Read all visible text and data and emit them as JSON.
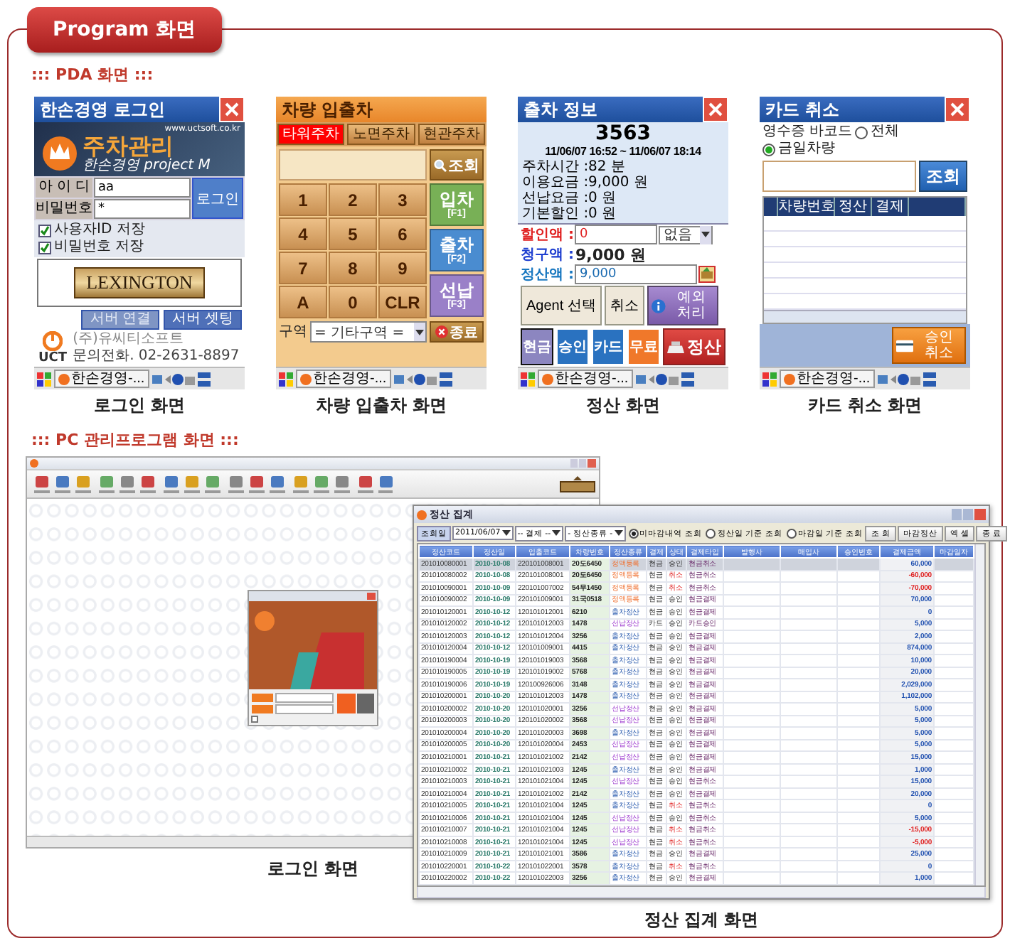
{
  "header": {
    "title": "Program 화면"
  },
  "pda_section": {
    "title": "::: PDA 화면 :::",
    "login_screen": {
      "title": "한손경영 로그인",
      "url": "www.uctsoft.co.kr",
      "banner_title": "주차관리",
      "banner_subtitle": "한손경영 project M",
      "id_label": "아 이 디",
      "id_value": "aa",
      "password_label": "비밀번호",
      "password_value": "*",
      "login_button": "로그인",
      "checkboxes": [
        {
          "label": "사용자ID 저장",
          "checked": true
        },
        {
          "label": "비밀번호 저장",
          "checked": true
        }
      ],
      "brand_logo": "LEXINGTON",
      "buttons": [
        {
          "label": "서버 연결",
          "disabled": true
        },
        {
          "label": "서버 셋팅",
          "disabled": false
        }
      ],
      "company_logo": "UCT",
      "company": "(주)유씨티소프트",
      "contact": "문의전화. 02-2631-8897",
      "taskbar_app": "한손경영-...",
      "caption": "로그인 화면"
    },
    "entry_screen": {
      "title": "차량 입출차",
      "tabs": [
        {
          "label": "타워주차",
          "selected": true
        },
        {
          "label": "노면주차",
          "selected": false
        },
        {
          "label": "현관주차",
          "selected": false
        }
      ],
      "search_button": "조회",
      "keys": [
        "1",
        "2",
        "3",
        "4",
        "5",
        "6",
        "7",
        "8",
        "9",
        "A",
        "0",
        "CLR"
      ],
      "actions": [
        {
          "label": "입차",
          "key": "[F1]",
          "color": "#78b056"
        },
        {
          "label": "출차",
          "key": "[F2]",
          "color": "#4a8cd0"
        },
        {
          "label": "선납",
          "key": "[F3]",
          "color": "#9a80c8"
        }
      ],
      "zone_label": "구역",
      "zone_value": "= 기타구역 =",
      "exit_button": "종료",
      "taskbar_app": "한손경영-...",
      "caption": "차량 입출차 화면"
    },
    "payment_screen": {
      "title": "출차 정보",
      "car_number": "3563",
      "period": "11/06/07 16:52 ~ 11/06/07 18:14",
      "info": [
        {
          "label": "주차시간",
          "value": ":82 분"
        },
        {
          "label": "이용요금",
          "value": ":9,000 원"
        },
        {
          "label": "선납요금",
          "value": ":0 원"
        },
        {
          "label": "기본할인",
          "value": ":0 원"
        }
      ],
      "discount_label": "할인액 :",
      "discount_value": "0",
      "discount_option": "없음",
      "billed_label": "청구액 :",
      "billed_value": "9,000 원",
      "settle_label": "정산액 :",
      "settle_value": "9,000",
      "agent_button": "Agent 선택",
      "cancel_button": "취소",
      "exception_button": "예외 처리",
      "pay_types": [
        {
          "label": "현금",
          "color": "#8c86c0",
          "selected": true
        },
        {
          "label": "승인",
          "color": "#2a72c0",
          "selected": false
        },
        {
          "label": "카드",
          "color": "#2a72c0",
          "selected": false
        },
        {
          "label": "무료",
          "color": "#f0782a",
          "selected": false
        }
      ],
      "settle_button": "정산",
      "taskbar_app": "한손경영-...",
      "caption": "정산 화면"
    },
    "card_cancel_screen": {
      "title": "카드 취소",
      "barcode_label": "영수증 바코드",
      "radios": [
        {
          "label": "전체",
          "selected": false
        },
        {
          "label": "금일차량",
          "selected": true
        }
      ],
      "search_button": "조회",
      "columns": [
        "차량번호",
        "정산",
        "결제"
      ],
      "cancel_button": "승인 취소",
      "taskbar_app": "한손경영-...",
      "caption": "카드 취소 화면"
    }
  },
  "pc_section": {
    "title": "::: PC 관리프로그램 화면 :::",
    "login_window": {
      "caption": "로그인 화면"
    },
    "settlement_window": {
      "title": "정산 집계",
      "toolbar": [
        {
          "kind": "label",
          "text": "조회일"
        },
        {
          "kind": "select",
          "text": "2011/06/07"
        },
        {
          "kind": "select",
          "text": "-- 결제 --"
        },
        {
          "kind": "select",
          "text": "- 정산종류 -"
        },
        {
          "kind": "radio",
          "text": "미마감내역 조회",
          "selected": true
        },
        {
          "kind": "radio",
          "text": "정산일 기준 조회",
          "selected": false
        },
        {
          "kind": "radio",
          "text": "마감일 기준 조회",
          "selected": false
        },
        {
          "kind": "button",
          "text": "조 회"
        },
        {
          "kind": "button",
          "text": "마감정산"
        },
        {
          "kind": "button",
          "text": "엑 셀"
        },
        {
          "kind": "button",
          "text": "종 료"
        }
      ],
      "columns": [
        "정산코드",
        "정산일",
        "입출코드",
        "차량번호",
        "정산종류",
        "결제",
        "상태",
        "결제타입",
        "발행사",
        "매입사",
        "승인번호",
        "결제금액",
        "마감일자"
      ],
      "rows": [
        {
          "code": "201010080001",
          "date": "2010-10-08",
          "io_code": "220101008001",
          "car": "20도6450",
          "type": "정액등록",
          "kind": "fixed",
          "pay": "현금",
          "status": "승인",
          "cancelled": false,
          "pay_type": "현금취소",
          "amount": "60,000",
          "refund": false,
          "selected": true
        },
        {
          "code": "201010080002",
          "date": "2010-10-08",
          "io_code": "220101008001",
          "car": "20도6450",
          "type": "정액등록",
          "kind": "fixed",
          "pay": "현금",
          "status": "취소",
          "cancelled": true,
          "pay_type": "현금취소",
          "amount": "-60,000",
          "refund": true,
          "selected": false
        },
        {
          "code": "201010090001",
          "date": "2010-10-09",
          "io_code": "220101007002",
          "car": "54무1450",
          "type": "정액등록",
          "kind": "fixed",
          "pay": "현금",
          "status": "취소",
          "cancelled": true,
          "pay_type": "현금취소",
          "amount": "-70,000",
          "refund": true,
          "selected": false
        },
        {
          "code": "201010090002",
          "date": "2010-10-09",
          "io_code": "220101009001",
          "car": "31국0518",
          "type": "정액등록",
          "kind": "fixed",
          "pay": "현금",
          "status": "승인",
          "cancelled": false,
          "pay_type": "현금결제",
          "amount": "70,000",
          "refund": false,
          "selected": false
        },
        {
          "code": "201010120001",
          "date": "2010-10-12",
          "io_code": "120101012001",
          "car": "6210",
          "type": "출차정산",
          "kind": "exit",
          "pay": "현금",
          "status": "승인",
          "cancelled": false,
          "pay_type": "현금결제",
          "amount": "0",
          "refund": false,
          "selected": false
        },
        {
          "code": "201010120002",
          "date": "2010-10-12",
          "io_code": "120101012003",
          "car": "1478",
          "type": "선납정산",
          "kind": "prepaid",
          "pay": "카드",
          "status": "승인",
          "cancelled": false,
          "pay_type": "카드승인",
          "amount": "5,000",
          "refund": false,
          "selected": false
        },
        {
          "code": "201010120003",
          "date": "2010-10-12",
          "io_code": "120101012004",
          "car": "3256",
          "type": "출차정산",
          "kind": "exit",
          "pay": "현금",
          "status": "승인",
          "cancelled": false,
          "pay_type": "현금결제",
          "amount": "2,000",
          "refund": false,
          "selected": false
        },
        {
          "code": "201010120004",
          "date": "2010-10-12",
          "io_code": "120101009001",
          "car": "4415",
          "type": "출차정산",
          "kind": "exit",
          "pay": "현금",
          "status": "승인",
          "cancelled": false,
          "pay_type": "현금결제",
          "amount": "874,000",
          "refund": false,
          "selected": false
        },
        {
          "code": "201010190004",
          "date": "2010-10-19",
          "io_code": "120101019003",
          "car": "3568",
          "type": "출차정산",
          "kind": "exit",
          "pay": "현금",
          "status": "승인",
          "cancelled": false,
          "pay_type": "현금결제",
          "amount": "10,000",
          "refund": false,
          "selected": false
        },
        {
          "code": "201010190005",
          "date": "2010-10-19",
          "io_code": "120101019002",
          "car": "5768",
          "type": "출차정산",
          "kind": "exit",
          "pay": "현금",
          "status": "승인",
          "cancelled": false,
          "pay_type": "현금결제",
          "amount": "20,000",
          "refund": false,
          "selected": false
        },
        {
          "code": "201010190006",
          "date": "2010-10-19",
          "io_code": "120100926006",
          "car": "3148",
          "type": "출차정산",
          "kind": "exit",
          "pay": "현금",
          "status": "승인",
          "cancelled": false,
          "pay_type": "현금결제",
          "amount": "2,029,000",
          "refund": false,
          "selected": false
        },
        {
          "code": "201010200001",
          "date": "2010-10-20",
          "io_code": "120101012003",
          "car": "1478",
          "type": "출차정산",
          "kind": "exit",
          "pay": "현금",
          "status": "승인",
          "cancelled": false,
          "pay_type": "현금결제",
          "amount": "1,102,000",
          "refund": false,
          "selected": false
        },
        {
          "code": "201010200002",
          "date": "2010-10-20",
          "io_code": "120101020001",
          "car": "3256",
          "type": "선납정산",
          "kind": "prepaid",
          "pay": "현금",
          "status": "승인",
          "cancelled": false,
          "pay_type": "현금결제",
          "amount": "5,000",
          "refund": false,
          "selected": false
        },
        {
          "code": "201010200003",
          "date": "2010-10-20",
          "io_code": "120101020002",
          "car": "3568",
          "type": "선납정산",
          "kind": "prepaid",
          "pay": "현금",
          "status": "승인",
          "cancelled": false,
          "pay_type": "현금결제",
          "amount": "5,000",
          "refund": false,
          "selected": false
        },
        {
          "code": "201010200004",
          "date": "2010-10-20",
          "io_code": "120101020003",
          "car": "3698",
          "type": "출차정산",
          "kind": "exit",
          "pay": "현금",
          "status": "승인",
          "cancelled": false,
          "pay_type": "현금결제",
          "amount": "5,000",
          "refund": false,
          "selected": false
        },
        {
          "code": "201010200005",
          "date": "2010-10-20",
          "io_code": "120101020004",
          "car": "2453",
          "type": "선납정산",
          "kind": "prepaid",
          "pay": "현금",
          "status": "승인",
          "cancelled": false,
          "pay_type": "현금결제",
          "amount": "5,000",
          "refund": false,
          "selected": false
        },
        {
          "code": "201010210001",
          "date": "2010-10-21",
          "io_code": "120101021002",
          "car": "2142",
          "type": "선납정산",
          "kind": "prepaid",
          "pay": "현금",
          "status": "승인",
          "cancelled": false,
          "pay_type": "현금결제",
          "amount": "15,000",
          "refund": false,
          "selected": false
        },
        {
          "code": "201010210002",
          "date": "2010-10-21",
          "io_code": "120101021003",
          "car": "1245",
          "type": "출차정산",
          "kind": "exit",
          "pay": "현금",
          "status": "승인",
          "cancelled": false,
          "pay_type": "현금결제",
          "amount": "1,000",
          "refund": false,
          "selected": false
        },
        {
          "code": "201010210003",
          "date": "2010-10-21",
          "io_code": "120101021004",
          "car": "1245",
          "type": "선납정산",
          "kind": "prepaid",
          "pay": "현금",
          "status": "승인",
          "cancelled": false,
          "pay_type": "현금취소",
          "amount": "15,000",
          "refund": false,
          "selected": false
        },
        {
          "code": "201010210004",
          "date": "2010-10-21",
          "io_code": "120101021002",
          "car": "2142",
          "type": "출차정산",
          "kind": "exit",
          "pay": "현금",
          "status": "승인",
          "cancelled": false,
          "pay_type": "현금결제",
          "amount": "20,000",
          "refund": false,
          "selected": false
        },
        {
          "code": "201010210005",
          "date": "2010-10-21",
          "io_code": "120101021004",
          "car": "1245",
          "type": "출차정산",
          "kind": "exit",
          "pay": "현금",
          "status": "취소",
          "cancelled": true,
          "pay_type": "현금취소",
          "amount": "0",
          "refund": false,
          "selected": false
        },
        {
          "code": "201010210006",
          "date": "2010-10-21",
          "io_code": "120101021004",
          "car": "1245",
          "type": "선납정산",
          "kind": "prepaid",
          "pay": "현금",
          "status": "승인",
          "cancelled": false,
          "pay_type": "현금취소",
          "amount": "5,000",
          "refund": false,
          "selected": false
        },
        {
          "code": "201010210007",
          "date": "2010-10-21",
          "io_code": "120101021004",
          "car": "1245",
          "type": "선납정산",
          "kind": "prepaid",
          "pay": "현금",
          "status": "취소",
          "cancelled": true,
          "pay_type": "현금취소",
          "amount": "-15,000",
          "refund": true,
          "selected": false
        },
        {
          "code": "201010210008",
          "date": "2010-10-21",
          "io_code": "120101021004",
          "car": "1245",
          "type": "선납정산",
          "kind": "prepaid",
          "pay": "현금",
          "status": "취소",
          "cancelled": true,
          "pay_type": "현금취소",
          "amount": "-5,000",
          "refund": true,
          "selected": false
        },
        {
          "code": "201010210009",
          "date": "2010-10-21",
          "io_code": "120101021001",
          "car": "3586",
          "type": "출차정산",
          "kind": "exit",
          "pay": "현금",
          "status": "승인",
          "cancelled": false,
          "pay_type": "현금결제",
          "amount": "25,000",
          "refund": false,
          "selected": false
        },
        {
          "code": "201010220001",
          "date": "2010-10-22",
          "io_code": "120101022001",
          "car": "3578",
          "type": "출차정산",
          "kind": "exit",
          "pay": "현금",
          "status": "취소",
          "cancelled": true,
          "pay_type": "현금취소",
          "amount": "0",
          "refund": false,
          "selected": false
        },
        {
          "code": "201010220002",
          "date": "2010-10-22",
          "io_code": "120101022003",
          "car": "3256",
          "type": "출차정산",
          "kind": "exit",
          "pay": "현금",
          "status": "승인",
          "cancelled": false,
          "pay_type": "현금결제",
          "amount": "1,000",
          "refund": false,
          "selected": false
        }
      ],
      "caption": "정산 집계 화면"
    }
  }
}
